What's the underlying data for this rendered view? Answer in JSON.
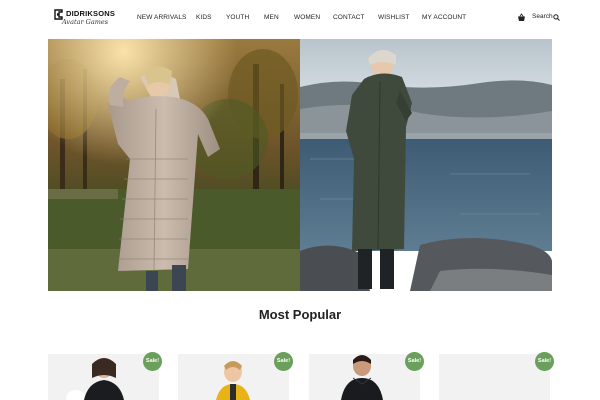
{
  "brand": {
    "name": "DIDRIKSONS",
    "tagline": "Avatar Games"
  },
  "nav": {
    "items": [
      {
        "label": "NEW ARRIVALS"
      },
      {
        "label": "KIDS"
      },
      {
        "label": "YOUTH"
      },
      {
        "label": "MEN"
      },
      {
        "label": "WOMEN"
      },
      {
        "label": "CONTACT"
      },
      {
        "label": "WISHLIST"
      },
      {
        "label": "MY ACCOUNT"
      }
    ]
  },
  "header": {
    "cart_icon": "basket-icon",
    "search_label": "Search",
    "search_icon": "search-icon"
  },
  "hero": {
    "left_image": "woman-in-beige-puffer-coat-autumn-forest",
    "right_image": "woman-in-dark-green-parka-by-lake"
  },
  "section": {
    "title": "Most Popular"
  },
  "products": [
    {
      "badge": "Sale!",
      "image": "woman-in-black-coat-fur-hood"
    },
    {
      "badge": "Sale!",
      "image": "child-in-yellow-jacket"
    },
    {
      "badge": "Sale!",
      "image": "man-in-black-jacket"
    },
    {
      "badge": "Sale!",
      "image": "product-image-placeholder"
    }
  ],
  "colors": {
    "sale_badge": "#6a9f5c",
    "card_background": "#f2f2f2",
    "text": "#222222"
  }
}
